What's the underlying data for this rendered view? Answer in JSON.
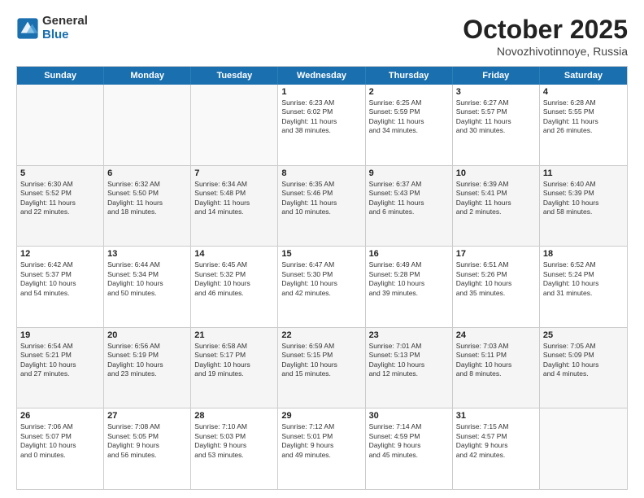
{
  "logo": {
    "general": "General",
    "blue": "Blue"
  },
  "header": {
    "month": "October 2025",
    "location": "Novozhivotinnoye, Russia"
  },
  "days": [
    "Sunday",
    "Monday",
    "Tuesday",
    "Wednesday",
    "Thursday",
    "Friday",
    "Saturday"
  ],
  "weeks": [
    [
      {
        "day": "",
        "text": ""
      },
      {
        "day": "",
        "text": ""
      },
      {
        "day": "",
        "text": ""
      },
      {
        "day": "1",
        "text": "Sunrise: 6:23 AM\nSunset: 6:02 PM\nDaylight: 11 hours\nand 38 minutes."
      },
      {
        "day": "2",
        "text": "Sunrise: 6:25 AM\nSunset: 5:59 PM\nDaylight: 11 hours\nand 34 minutes."
      },
      {
        "day": "3",
        "text": "Sunrise: 6:27 AM\nSunset: 5:57 PM\nDaylight: 11 hours\nand 30 minutes."
      },
      {
        "day": "4",
        "text": "Sunrise: 6:28 AM\nSunset: 5:55 PM\nDaylight: 11 hours\nand 26 minutes."
      }
    ],
    [
      {
        "day": "5",
        "text": "Sunrise: 6:30 AM\nSunset: 5:52 PM\nDaylight: 11 hours\nand 22 minutes."
      },
      {
        "day": "6",
        "text": "Sunrise: 6:32 AM\nSunset: 5:50 PM\nDaylight: 11 hours\nand 18 minutes."
      },
      {
        "day": "7",
        "text": "Sunrise: 6:34 AM\nSunset: 5:48 PM\nDaylight: 11 hours\nand 14 minutes."
      },
      {
        "day": "8",
        "text": "Sunrise: 6:35 AM\nSunset: 5:46 PM\nDaylight: 11 hours\nand 10 minutes."
      },
      {
        "day": "9",
        "text": "Sunrise: 6:37 AM\nSunset: 5:43 PM\nDaylight: 11 hours\nand 6 minutes."
      },
      {
        "day": "10",
        "text": "Sunrise: 6:39 AM\nSunset: 5:41 PM\nDaylight: 11 hours\nand 2 minutes."
      },
      {
        "day": "11",
        "text": "Sunrise: 6:40 AM\nSunset: 5:39 PM\nDaylight: 10 hours\nand 58 minutes."
      }
    ],
    [
      {
        "day": "12",
        "text": "Sunrise: 6:42 AM\nSunset: 5:37 PM\nDaylight: 10 hours\nand 54 minutes."
      },
      {
        "day": "13",
        "text": "Sunrise: 6:44 AM\nSunset: 5:34 PM\nDaylight: 10 hours\nand 50 minutes."
      },
      {
        "day": "14",
        "text": "Sunrise: 6:45 AM\nSunset: 5:32 PM\nDaylight: 10 hours\nand 46 minutes."
      },
      {
        "day": "15",
        "text": "Sunrise: 6:47 AM\nSunset: 5:30 PM\nDaylight: 10 hours\nand 42 minutes."
      },
      {
        "day": "16",
        "text": "Sunrise: 6:49 AM\nSunset: 5:28 PM\nDaylight: 10 hours\nand 39 minutes."
      },
      {
        "day": "17",
        "text": "Sunrise: 6:51 AM\nSunset: 5:26 PM\nDaylight: 10 hours\nand 35 minutes."
      },
      {
        "day": "18",
        "text": "Sunrise: 6:52 AM\nSunset: 5:24 PM\nDaylight: 10 hours\nand 31 minutes."
      }
    ],
    [
      {
        "day": "19",
        "text": "Sunrise: 6:54 AM\nSunset: 5:21 PM\nDaylight: 10 hours\nand 27 minutes."
      },
      {
        "day": "20",
        "text": "Sunrise: 6:56 AM\nSunset: 5:19 PM\nDaylight: 10 hours\nand 23 minutes."
      },
      {
        "day": "21",
        "text": "Sunrise: 6:58 AM\nSunset: 5:17 PM\nDaylight: 10 hours\nand 19 minutes."
      },
      {
        "day": "22",
        "text": "Sunrise: 6:59 AM\nSunset: 5:15 PM\nDaylight: 10 hours\nand 15 minutes."
      },
      {
        "day": "23",
        "text": "Sunrise: 7:01 AM\nSunset: 5:13 PM\nDaylight: 10 hours\nand 12 minutes."
      },
      {
        "day": "24",
        "text": "Sunrise: 7:03 AM\nSunset: 5:11 PM\nDaylight: 10 hours\nand 8 minutes."
      },
      {
        "day": "25",
        "text": "Sunrise: 7:05 AM\nSunset: 5:09 PM\nDaylight: 10 hours\nand 4 minutes."
      }
    ],
    [
      {
        "day": "26",
        "text": "Sunrise: 7:06 AM\nSunset: 5:07 PM\nDaylight: 10 hours\nand 0 minutes."
      },
      {
        "day": "27",
        "text": "Sunrise: 7:08 AM\nSunset: 5:05 PM\nDaylight: 9 hours\nand 56 minutes."
      },
      {
        "day": "28",
        "text": "Sunrise: 7:10 AM\nSunset: 5:03 PM\nDaylight: 9 hours\nand 53 minutes."
      },
      {
        "day": "29",
        "text": "Sunrise: 7:12 AM\nSunset: 5:01 PM\nDaylight: 9 hours\nand 49 minutes."
      },
      {
        "day": "30",
        "text": "Sunrise: 7:14 AM\nSunset: 4:59 PM\nDaylight: 9 hours\nand 45 minutes."
      },
      {
        "day": "31",
        "text": "Sunrise: 7:15 AM\nSunset: 4:57 PM\nDaylight: 9 hours\nand 42 minutes."
      },
      {
        "day": "",
        "text": ""
      }
    ]
  ]
}
